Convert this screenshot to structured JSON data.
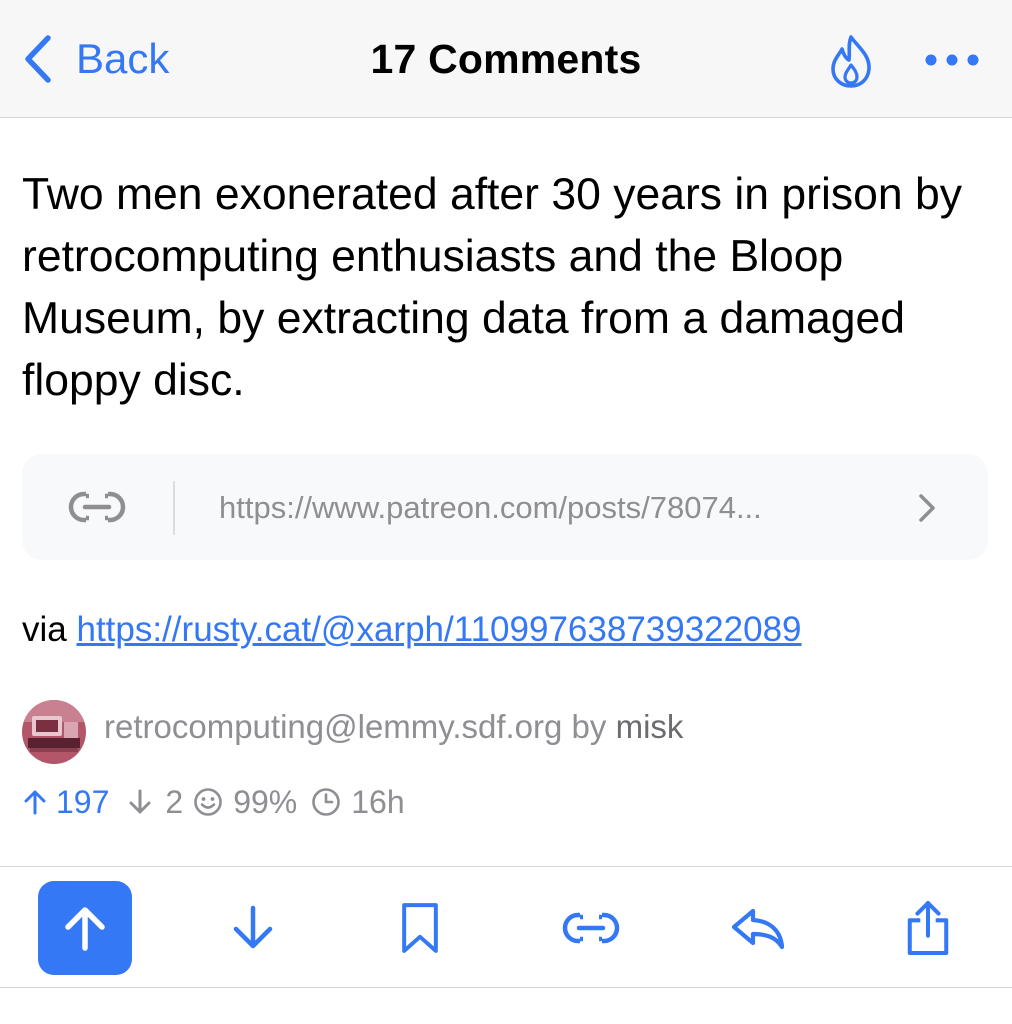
{
  "nav": {
    "back_label": "Back",
    "title": "17 Comments",
    "icons": [
      "chevron-left-icon",
      "flame-icon",
      "more-icon"
    ]
  },
  "post": {
    "title": "Two men exonerated after 30 years in prison by retrocomputing enthusiasts and the Bloop Museum, by extracting data from a damaged floppy disc.",
    "link_url": "https://www.patreon.com/posts/78074...",
    "via_prefix": "via",
    "via_link": "https://rusty.cat/@xarph/110997638739322089",
    "community": "retrocomputing@lemmy.sdf.org",
    "by_label": "by",
    "author": "misk",
    "upvotes": "197",
    "downvotes": "2",
    "upvote_ratio": "99%",
    "age": "16h"
  },
  "toolbar": {
    "icons": [
      "upvote-icon",
      "downvote-icon",
      "bookmark-icon",
      "link-icon",
      "reply-icon",
      "share-icon"
    ],
    "active": "upvote"
  },
  "colors": {
    "accent": "#3478f6",
    "secondary_text": "#8e8e93",
    "nav_background": "#f7f7f7",
    "card_background": "#f8f9fa"
  }
}
